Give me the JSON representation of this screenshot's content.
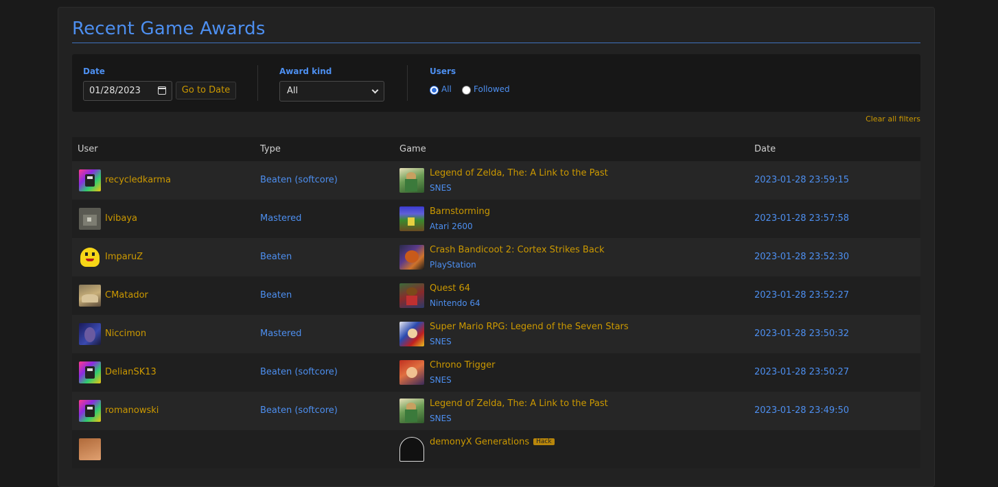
{
  "page": {
    "title": "Recent Game Awards"
  },
  "filters": {
    "date_label": "Date",
    "date_value": "01/28/2023",
    "go_to_date_label": "Go to Date",
    "award_kind_label": "Award kind",
    "award_kind_value": "All",
    "users_label": "Users",
    "users_options": [
      {
        "label": "All",
        "selected": true
      },
      {
        "label": "Followed",
        "selected": false
      }
    ],
    "clear_all_label": "Clear all filters"
  },
  "table": {
    "headers": {
      "user": "User",
      "type": "Type",
      "game": "Game",
      "date": "Date"
    },
    "rows": [
      {
        "user": "recycledkarma",
        "type": "Beaten (softcore)",
        "game": "Legend of Zelda, The: A Link to the Past",
        "system": "SNES",
        "date": "2023-01-28 23:59:15"
      },
      {
        "user": "Ivibaya",
        "type": "Mastered",
        "game": "Barnstorming",
        "system": "Atari 2600",
        "date": "2023-01-28 23:57:58"
      },
      {
        "user": "ImparuZ",
        "type": "Beaten",
        "game": "Crash Bandicoot 2: Cortex Strikes Back",
        "system": "PlayStation",
        "date": "2023-01-28 23:52:30"
      },
      {
        "user": "CMatador",
        "type": "Beaten",
        "game": "Quest 64",
        "system": "Nintendo 64",
        "date": "2023-01-28 23:52:27"
      },
      {
        "user": "Niccimon",
        "type": "Mastered",
        "game": "Super Mario RPG: Legend of the Seven Stars",
        "system": "SNES",
        "date": "2023-01-28 23:50:32"
      },
      {
        "user": "DelianSK13",
        "type": "Beaten (softcore)",
        "game": "Chrono Trigger",
        "system": "SNES",
        "date": "2023-01-28 23:50:27"
      },
      {
        "user": "romanowski",
        "type": "Beaten (softcore)",
        "game": "Legend of Zelda, The: A Link to the Past",
        "system": "SNES",
        "date": "2023-01-28 23:49:50"
      },
      {
        "user": "",
        "type": "",
        "game": "demonyX Generations",
        "tag": "Hack",
        "system": "",
        "date": ""
      }
    ]
  },
  "colors": {
    "accent_blue": "#4d8ff0",
    "link_gold": "#cc9900",
    "background": "#1a1a1a",
    "panel": "#222222"
  }
}
